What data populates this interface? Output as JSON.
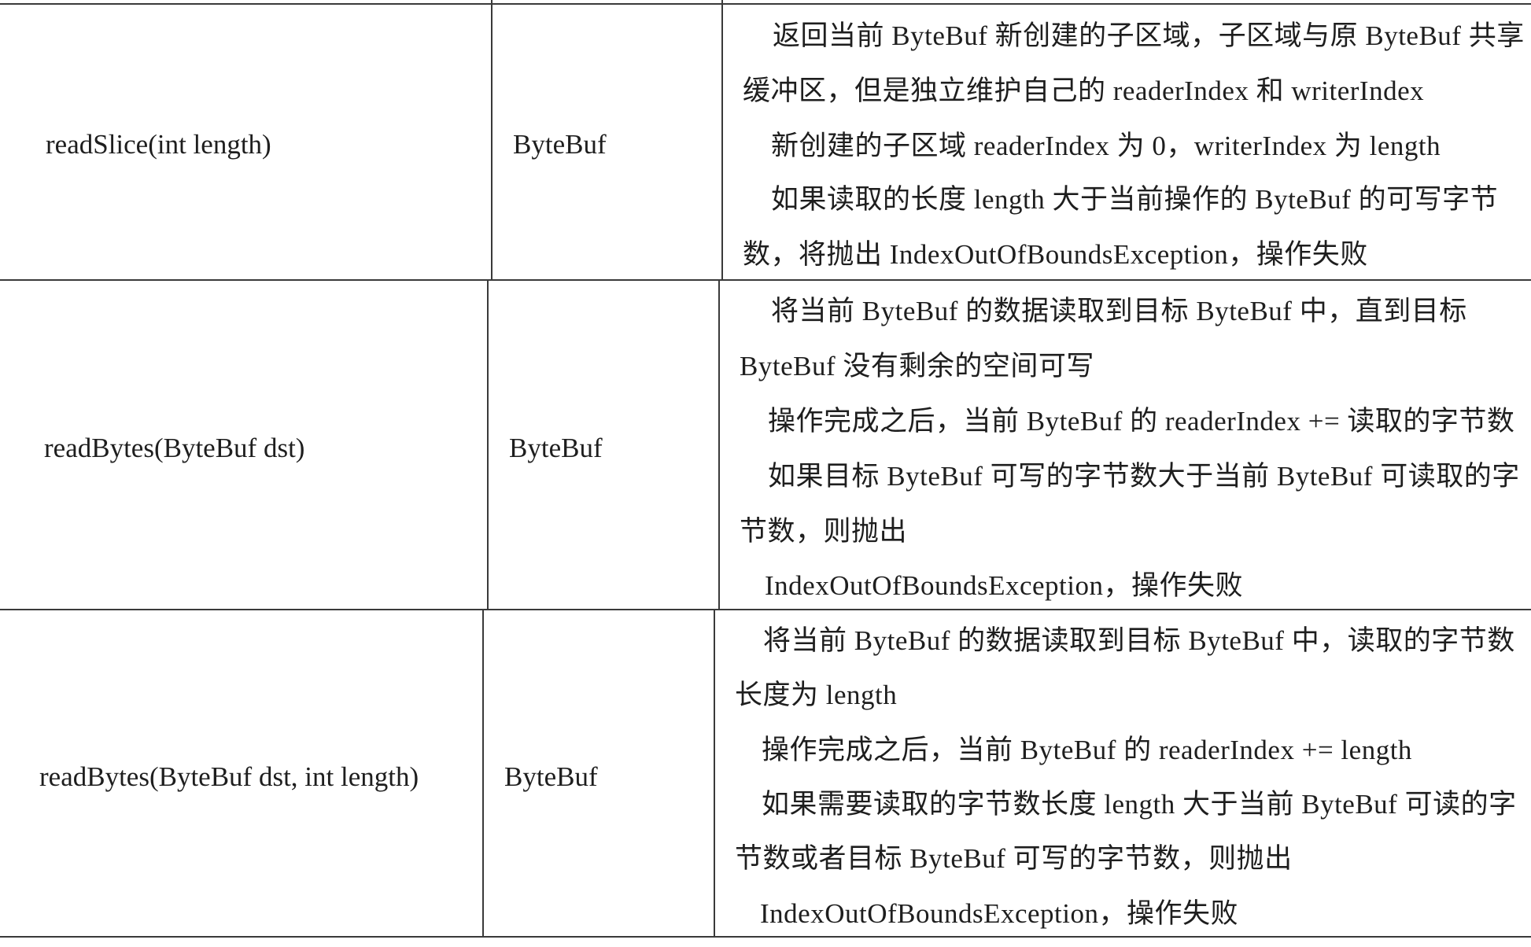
{
  "rows": [
    {
      "method": "readSlice(int length)",
      "return_type": "ByteBuf",
      "description": [
        "返回当前 ByteBuf 新创建的子区域，子区域与原 ByteBuf 共享",
        "缓冲区，但是独立维护自己的 readerIndex 和 writerIndex",
        "新创建的子区域 readerIndex 为 0，writerIndex 为 length",
        "如果读取的长度 length 大于当前操作的 ByteBuf 的可写字节",
        "数，将抛出 IndexOutOfBoundsException，操作失败"
      ]
    },
    {
      "method": "readBytes(ByteBuf dst)",
      "return_type": "ByteBuf",
      "description": [
        "将当前 ByteBuf 的数据读取到目标 ByteBuf 中，直到目标",
        "ByteBuf 没有剩余的空间可写",
        "操作完成之后，当前 ByteBuf 的 readerIndex += 读取的字节数",
        "如果目标 ByteBuf 可写的字节数大于当前 ByteBuf 可读取的字",
        "节数，则抛出",
        "IndexOutOfBoundsException，操作失败"
      ]
    },
    {
      "method": "readBytes(ByteBuf dst, int length)",
      "return_type": "ByteBuf",
      "description": [
        "将当前 ByteBuf 的数据读取到目标 ByteBuf 中，读取的字节数",
        "长度为 length",
        "操作完成之后，当前 ByteBuf 的 readerIndex += length",
        "如果需要读取的字节数长度 length 大于当前 ByteBuf 可读的字",
        "节数或者目标 ByteBuf 可写的字节数，则抛出",
        "IndexOutOfBoundsException，操作失败"
      ]
    }
  ]
}
